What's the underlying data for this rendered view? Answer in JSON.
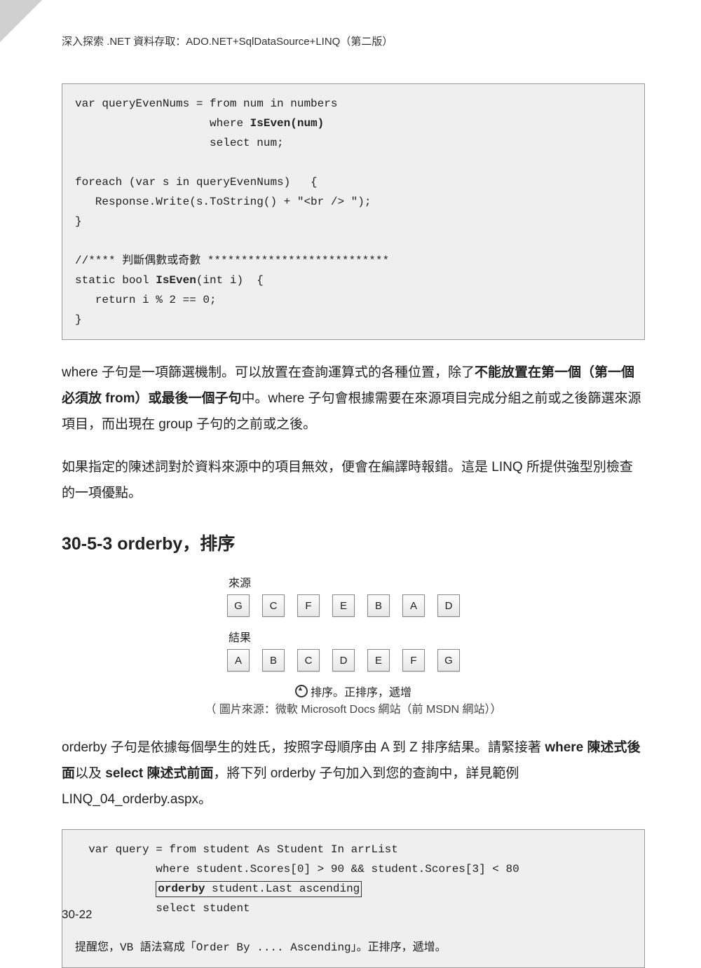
{
  "header": {
    "title": "深入探索 .NET 資料存取：ADO.NET+SqlDataSource+LINQ（第二版）"
  },
  "code1": {
    "l1a": "var queryEvenNums = from num in numbers",
    "l2a": "                    where ",
    "l2b": "IsEven(num)",
    "l3": "                    select num;",
    "l4": "",
    "l5": "foreach (var s in queryEvenNums)   {",
    "l6": "   Response.Write(s.ToString() + \"<br /> \");",
    "l7": "}",
    "l8": "",
    "l9": "//**** 判斷偶數或奇數 ***************************",
    "l10a": "static bool ",
    "l10b": "IsEven",
    "l10c": "(int i)  {",
    "l11": "   return i % 2 == 0;",
    "l12": "}"
  },
  "para1": {
    "t1": "where 子句是一項篩選機制。可以放置在查詢運算式的各種位置，除了",
    "b1": "不能放置在第一個（第一個必須放 from）或最後一個子句",
    "t2": "中。where 子句會根據需要在來源項目完成分組之前或之後篩選來源項目，而出現在 group 子句的之前或之後。"
  },
  "para2": {
    "t": "如果指定的陳述詞對於資料來源中的項目無效，便會在編譯時報錯。這是 LINQ 所提供強型別檢查的一項優點。"
  },
  "section": {
    "title": "30-5-3  orderby，排序"
  },
  "diagram": {
    "srcLabel": "來源",
    "resLabel": "結果",
    "src": [
      "G",
      "C",
      "F",
      "E",
      "B",
      "A",
      "D"
    ],
    "res": [
      "A",
      "B",
      "C",
      "D",
      "E",
      "F",
      "G"
    ],
    "cap1": "排序。正排序，遞增",
    "cap2": "（ 圖片來源：微軟 Microsoft Docs 網站（前 MSDN 網站））"
  },
  "para3": {
    "t1": "orderby 子句是依據每個學生的姓氏，按照字母順序由 A 到 Z 排序結果。請緊接著 ",
    "b1": "where 陳述式後面",
    "t2": "以及 ",
    "b2": "select 陳述式前面",
    "t3": "，將下列 orderby 子句加入到您的查詢中，詳見範例 LINQ_04_orderby.aspx。"
  },
  "code2": {
    "l1": "  var query = from student As Student In arrList",
    "l2": "            where student.Scores[0] > 90 && student.Scores[3] < 80",
    "l3a": "            ",
    "l3b": "orderby",
    "l3c": " student.Last ascending",
    "l4": "            select student",
    "l5": "",
    "l6": "提醒您，VB 語法寫成「Order By .... Ascending」。正排序，遞增。"
  },
  "pageNumber": "30-22"
}
